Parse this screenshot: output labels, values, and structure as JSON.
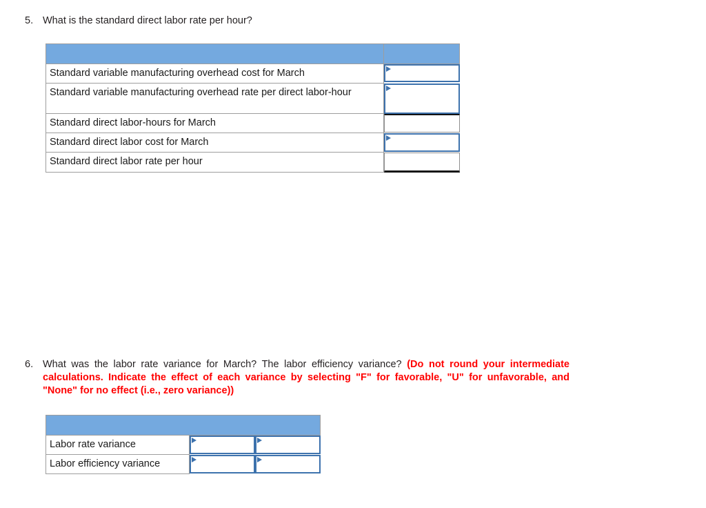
{
  "questions": [
    {
      "number": "5.",
      "text": "What is the standard direct labor rate per hour?"
    },
    {
      "number": "6.",
      "text_plain": "What was the labor rate variance for March? The labor efficiency variance? ",
      "text_emphasis": "(Do not round your intermediate calculations. Indicate the effect of each variance by selecting \"F\" for favorable, \"U\" for unfavorable, and \"None\" for no effect (i.e., zero variance))"
    }
  ],
  "tables": {
    "standards": {
      "header_fill": "#74A9DF",
      "header_label": "",
      "rows": [
        {
          "label": "Standard variable manufacturing overhead cost for March",
          "value": "",
          "input_style": "blue"
        },
        {
          "label": "Standard variable manufacturing overhead rate per direct labor-hour",
          "value": "",
          "input_style": "blue"
        },
        {
          "label": "Standard direct labor-hours for March",
          "value": "",
          "input_style": "plain"
        },
        {
          "label": "Standard direct labor cost for March",
          "value": "",
          "input_style": "blue"
        },
        {
          "label": "Standard direct labor rate per hour",
          "value": "",
          "input_style": "plain-last"
        }
      ]
    },
    "variances": {
      "header_fill": "#74A9DF",
      "header_label": "",
      "rows": [
        {
          "label": "Labor rate variance",
          "value_amount": "",
          "value_effect": ""
        },
        {
          "label": "Labor efficiency variance",
          "value_amount": "",
          "value_effect": ""
        }
      ]
    }
  },
  "colors": {
    "header_blue": "#74A9DF",
    "input_border_blue": "#3d72ad",
    "emphasis_red": "#ff0000",
    "grid_gray": "#9d9d9d"
  }
}
